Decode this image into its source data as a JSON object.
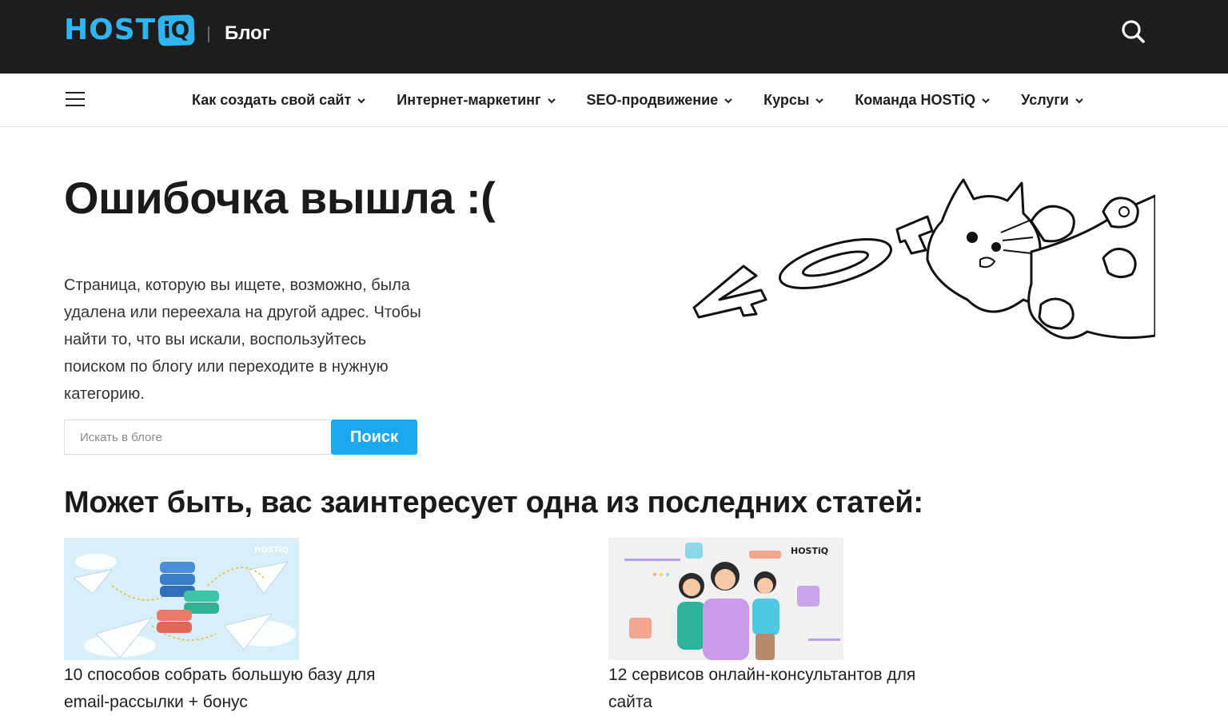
{
  "header": {
    "logo_text": "HOST",
    "logo_badge": "iQ",
    "section_label": "Блог",
    "search_icon": "search-icon"
  },
  "nav": {
    "menu_icon": "hamburger-icon",
    "items": [
      {
        "label": "Как создать свой сайт"
      },
      {
        "label": "Интернет-маркетинг"
      },
      {
        "label": "SEO-продвижение"
      },
      {
        "label": "Курсы"
      },
      {
        "label": "Команда HOSTiQ"
      },
      {
        "label": "Услуги"
      }
    ]
  },
  "error": {
    "title": "Ошибочка вышла :(",
    "message": "Страница, которую вы ищете, возможно, была удалена или переехала на другой адрес. Чтобы найти то, что вы искали, воспользуйтесь поиском по блогу или переходите в нужную категорию.",
    "search_placeholder": "Искать в блоге",
    "search_button": "Поиск",
    "illustration_text": "404"
  },
  "related": {
    "heading": "Может быть, вас заинтересует одна из последних статей:",
    "articles": [
      {
        "title": "10 способов собрать большую базу для email-рассылки + бонус",
        "thumb_logo": "HOSTiQ"
      },
      {
        "title": "12 сервисов онлайн-консультантов для сайта",
        "thumb_logo": "HOSTiQ"
      }
    ]
  },
  "colors": {
    "topbar": "#1d1d1d",
    "brand": "#2fb5f0",
    "button": "#1aa8ee"
  }
}
